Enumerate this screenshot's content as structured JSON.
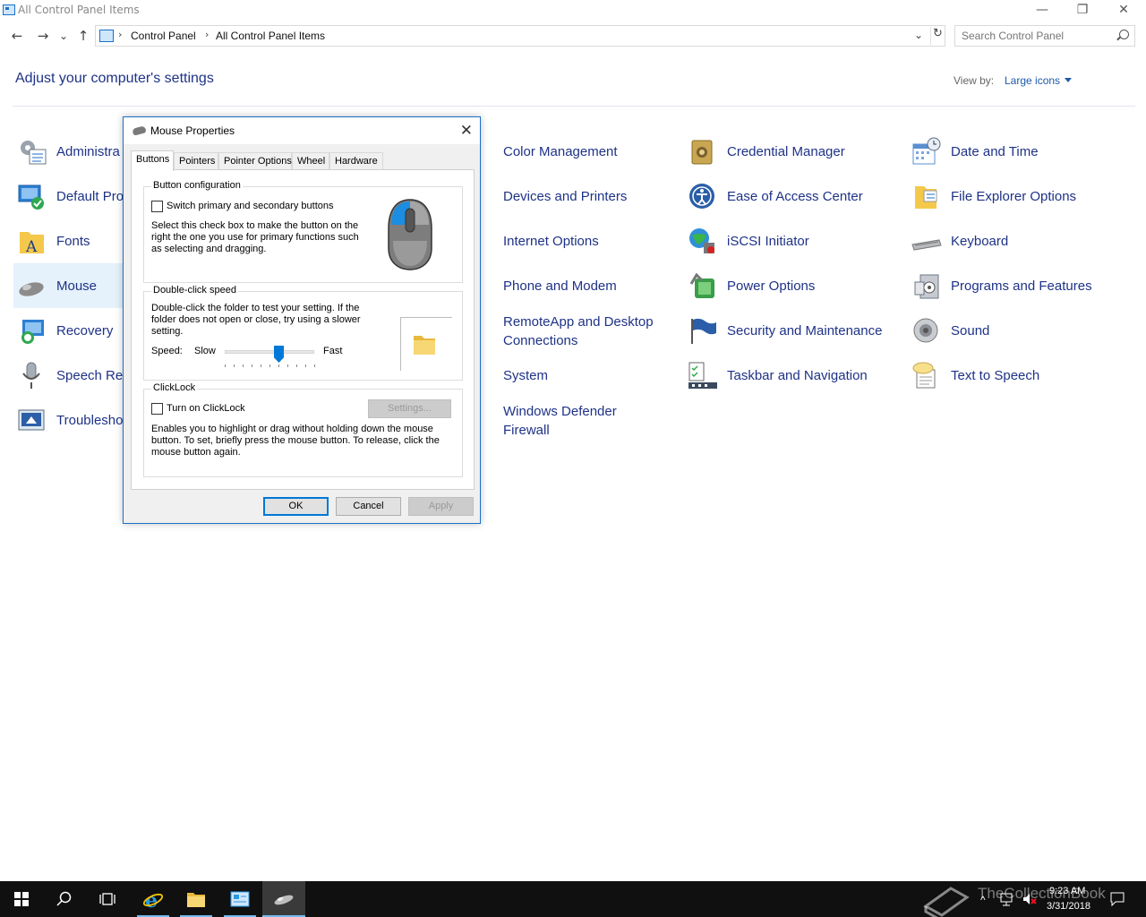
{
  "window": {
    "title": "All Control Panel Items",
    "minimize": "—",
    "restore": "❐",
    "close": "✕"
  },
  "nav": {
    "back": "←",
    "forward": "→",
    "recent": "⌄",
    "up": "↑"
  },
  "address": {
    "crumbs": [
      "Control Panel",
      "All Control Panel Items"
    ],
    "separator": "›",
    "dropdown": "⌄",
    "refresh": "↻"
  },
  "search": {
    "placeholder": "Search Control Panel"
  },
  "heading": "Adjust your computer's settings",
  "view_by": {
    "label": "View by:",
    "value": "Large icons"
  },
  "items": {
    "col1": [
      "Administra",
      "Default Pro",
      "Fonts",
      "Mouse",
      "Recovery",
      "Speech Rec",
      "Troublesho"
    ],
    "col2": [
      "Color Management",
      "Devices and Printers",
      "Internet Options",
      "Phone and Modem",
      "RemoteApp and Desktop",
      "Connections",
      "System",
      "Windows Defender",
      "Firewall"
    ],
    "col3": [
      "Credential Manager",
      "Ease of Access Center",
      "iSCSI Initiator",
      "Power Options",
      "Security and Maintenance",
      "Taskbar and Navigation"
    ],
    "col4": [
      "Date and Time",
      "File Explorer Options",
      "Keyboard",
      "Programs and Features",
      "Sound",
      "Text to Speech"
    ]
  },
  "dialog": {
    "title": "Mouse Properties",
    "close": "✕",
    "tabs": [
      "Buttons",
      "Pointers",
      "Pointer Options",
      "Wheel",
      "Hardware"
    ],
    "button_config": {
      "title": "Button configuration",
      "checkbox_label": "Switch primary and secondary buttons",
      "description": [
        "Select this check box to make the button on the",
        "right the one you use for primary functions such",
        "as selecting and dragging."
      ]
    },
    "double_click": {
      "title": "Double-click speed",
      "description": [
        "Double-click the folder to test your setting. If the",
        "folder does not open or close, try using a slower",
        "setting."
      ],
      "speed_label": "Speed:",
      "slow": "Slow",
      "fast": "Fast",
      "speed_level": 0.6
    },
    "clicklock": {
      "title": "ClickLock",
      "checkbox_label": "Turn on ClickLock",
      "settings_button": "Settings...",
      "description": [
        "Enables you to highlight or drag without holding down the mouse",
        "button. To set, briefly press the mouse button. To release, click the",
        "mouse button again."
      ]
    },
    "ok": "OK",
    "cancel": "Cancel",
    "apply": "Apply"
  },
  "taskbar": {
    "time": "9:23 AM",
    "date": "3/31/2018"
  },
  "watermark": "TheCollectionBook",
  "colors": {
    "link": "#1e3287",
    "accent": "#0078d7",
    "selection": "#e5f1fb"
  }
}
